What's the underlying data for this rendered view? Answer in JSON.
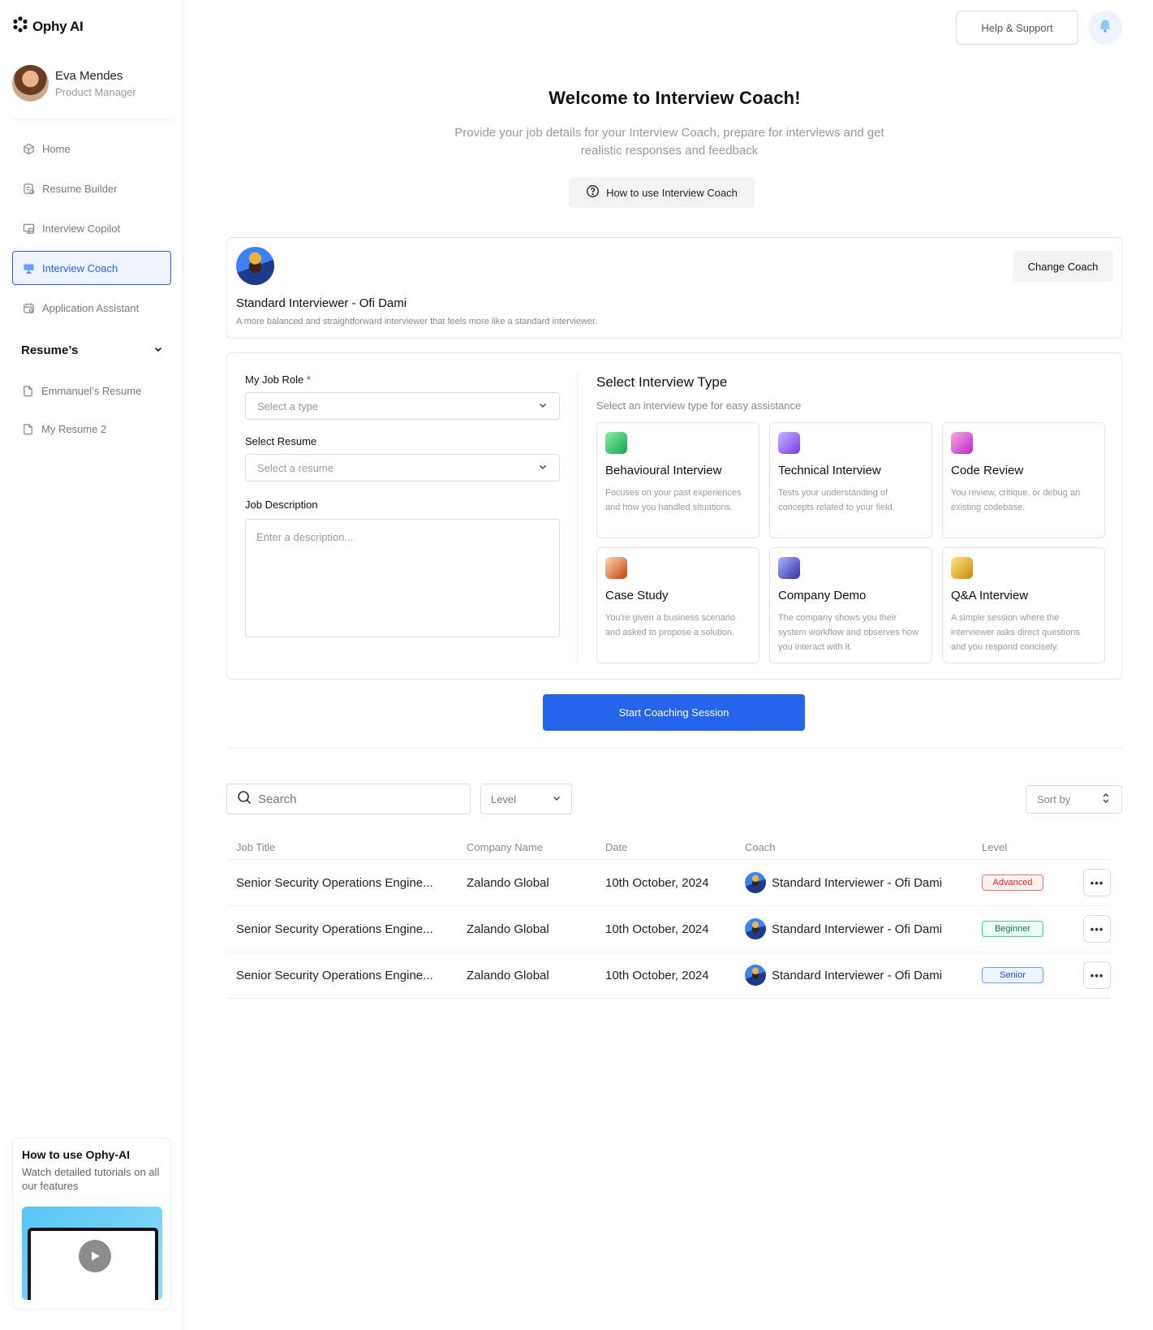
{
  "brand": {
    "name": "Ophy AI"
  },
  "user": {
    "name": "Eva Mendes",
    "role": "Product Manager"
  },
  "nav": [
    {
      "label": "Home",
      "icon": "home-icon",
      "active": false
    },
    {
      "label": "Resume Builder",
      "icon": "resume-builder-icon",
      "active": false
    },
    {
      "label": "Interview Copilot",
      "icon": "interview-copilot-icon",
      "active": false
    },
    {
      "label": "Interview Coach",
      "icon": "interview-coach-icon",
      "active": true
    },
    {
      "label": "Application Assistant",
      "icon": "application-assistant-icon",
      "active": false
    }
  ],
  "resumes": {
    "heading": "Resume’s",
    "items": [
      {
        "label": "Emmanuel’s Resume"
      },
      {
        "label": "My Resume 2"
      }
    ]
  },
  "tutorial": {
    "title": "How to use Ophy-AI",
    "description": "Watch detailed tutorials on all our features"
  },
  "header": {
    "help_label": "Help & Support"
  },
  "welcome": {
    "title": "Welcome to Interview Coach!",
    "subtitle": "Provide your job details for your Interview Coach, prepare for interviews and get realistic responses and feedback",
    "how_label": "How to use Interview Coach"
  },
  "coach": {
    "name": "Standard Interviewer - Ofi Dami",
    "description": "A more balanced and straightforward interviewer that feels more like a standard interviewer.",
    "change_label": "Change Coach"
  },
  "form": {
    "job_role_label": "My Job Role",
    "job_role_required": "*",
    "job_role_placeholder": "Select a type",
    "resume_label": "Select Resume",
    "resume_placeholder": "Select a resume",
    "description_label": "Job Description",
    "description_placeholder": "Enter a description..."
  },
  "interview_types": {
    "title": "Select Interview Type",
    "subtitle": "Select an interview type for easy assistance",
    "items": [
      {
        "name": "Behavioural Interview",
        "description": "Focuses on your past experiences and how you handled situations.",
        "color": "#22c55e"
      },
      {
        "name": "Technical Interview",
        "description": "Tests your understanding of concepts related to your field.",
        "color": "#8b5cf6"
      },
      {
        "name": "Code Review",
        "description": "You review, critique, or debug an existing codebase.",
        "color": "#ec4899"
      },
      {
        "name": "Case Study",
        "description": "You're given a business scenario and asked to propose a solution.",
        "color": "#d97706"
      },
      {
        "name": "Company Demo",
        "description": "The company shows you their system workflow and observes how you  interact with it.",
        "color": "#4f46e5"
      },
      {
        "name": "Q&A Interview",
        "description": "A simple session where the interviewer asks direct questions and you respond concisely.",
        "color": "#eab308"
      }
    ]
  },
  "start_label": "Start Coaching Session",
  "filters": {
    "search_placeholder": "Search",
    "level_label": "Level",
    "sort_label": "Sort by"
  },
  "table": {
    "headers": [
      "Job Title",
      "Company Name",
      "Date",
      "Coach",
      "Level"
    ],
    "rows": [
      {
        "title": "Senior Security Operations Engine...",
        "company": "Zalando Global",
        "date": "10th October, 2024",
        "coach": "Standard Interviewer - Ofi Dami",
        "level": "Advanced",
        "level_color": "#dc2626"
      },
      {
        "title": "Senior Security Operations Engine...",
        "company": "Zalando Global",
        "date": "10th October, 2024",
        "coach": "Standard Interviewer - Ofi Dami",
        "level": "Beginner",
        "level_color": "#047857"
      },
      {
        "title": "Senior Security Operations Engine...",
        "company": "Zalando Global",
        "date": "10th October, 2024",
        "coach": "Standard Interviewer - Ofi Dami",
        "level": "Senior",
        "level_color": "#1d4ed8"
      }
    ]
  },
  "colors": {
    "accent": "#2563eb"
  }
}
